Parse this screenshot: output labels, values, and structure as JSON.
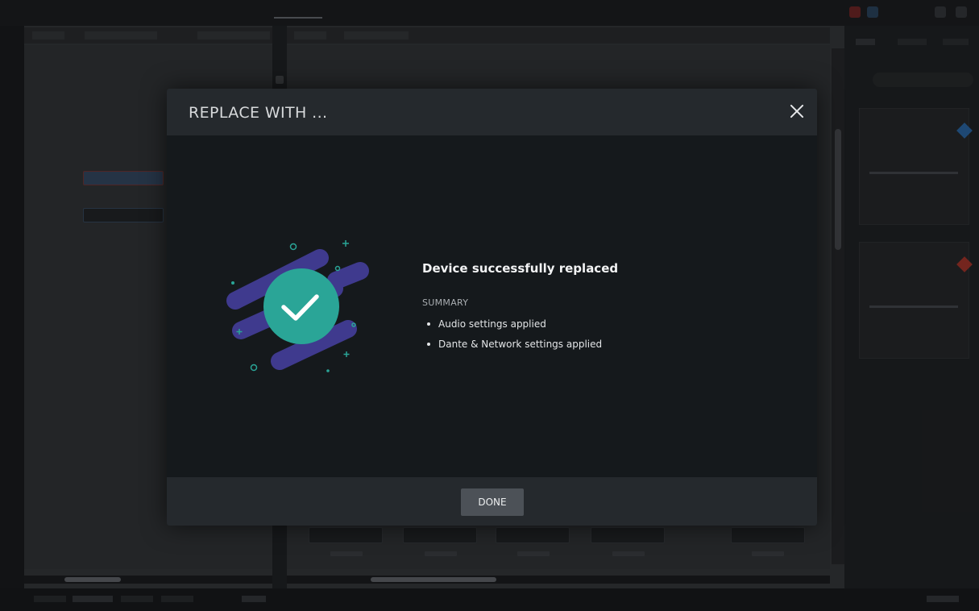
{
  "modal": {
    "title": "REPLACE WITH ...",
    "success_title": "Device successfully replaced",
    "summary_label": "SUMMARY",
    "summary_items": [
      "Audio settings applied",
      "Dante & Network settings applied"
    ],
    "done_label": "DONE",
    "close_icon": "close-icon",
    "success_icon": "checkmark-icon"
  },
  "colors": {
    "accent_teal": "#2aa597",
    "accent_purple": "#3f3a8e",
    "header_bg": "#25292d",
    "body_bg": "#15191c"
  }
}
